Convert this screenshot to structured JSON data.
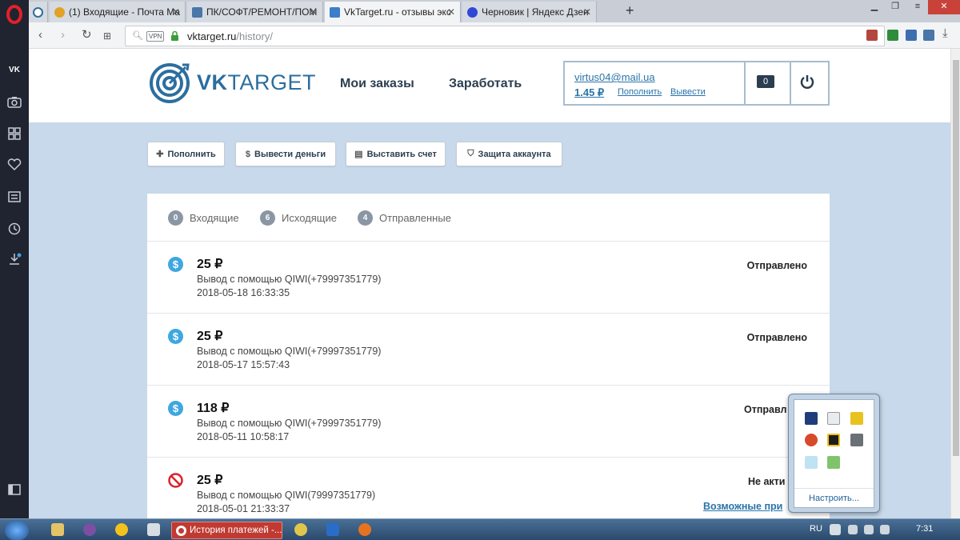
{
  "browser": {
    "tabs": [
      {
        "title": "(1) Входящие - Почта Ма",
        "favicon": "mail-icon",
        "color": "#e0a227"
      },
      {
        "title": "ПК/СОФТ/РЕМОНТ/ПОМ",
        "favicon": "vk-icon",
        "color": "#4a76a8"
      },
      {
        "title": "VkTarget.ru - отзывы экс",
        "favicon": "vk-like-icon",
        "color": "#3d7ec9"
      },
      {
        "title": "Черновик | Яндекс Дзен",
        "favicon": "zen-icon",
        "color": "#3147d6"
      }
    ],
    "address": {
      "vpn_label": "VPN",
      "host": "vktarget.ru",
      "path": "/history/"
    }
  },
  "site": {
    "brand_vk": "VK",
    "brand_target": "TARGET",
    "nav": {
      "orders": "Мои заказы",
      "earn": "Заработать"
    },
    "account": {
      "email": "virtus04@mail.ua",
      "balance": "1.45 ₽",
      "deposit_link": "Пополнить",
      "withdraw_link": "Вывести",
      "notifications": "0"
    }
  },
  "actions": {
    "deposit": "Пополнить",
    "withdraw": "Вывести деньги",
    "invoice": "Выставить счет",
    "security": "Защита аккаунта"
  },
  "filters": [
    {
      "count": "0",
      "label": "Входящие"
    },
    {
      "count": "6",
      "label": "Исходящие"
    },
    {
      "count": "4",
      "label": "Отправленные"
    }
  ],
  "transactions": [
    {
      "amount": "25 ₽",
      "description": "Вывод с помощью QIWI(+79997351779)",
      "date": "2018-05-18 16:33:35",
      "status": "Отправлено",
      "kind": "dollar-icon"
    },
    {
      "amount": "25 ₽",
      "description": "Вывод с помощью QIWI(+79997351779)",
      "date": "2018-05-17 15:57:43",
      "status": "Отправлено",
      "kind": "dollar-icon"
    },
    {
      "amount": "118 ₽",
      "description": "Вывод с помощью QIWI(+79997351779)",
      "date": "2018-05-11 10:58:17",
      "status": "Отправл",
      "kind": "dollar-icon"
    },
    {
      "amount": "25 ₽",
      "description": "Вывод с помощью QIWI(79997351779)",
      "date": "2018-05-01 21:33:37",
      "status": "Не акти",
      "kind": "cancelled-icon"
    }
  ],
  "possible_link": "Возможные при",
  "tray_popup": {
    "configure": "Настроить..."
  },
  "taskbar": {
    "active_task": "История платежей -...",
    "language": "RU",
    "time": "7:31"
  },
  "colors": {
    "brand": "#2c6e9e",
    "page_bg": "#c7d9ea",
    "dollar": "#3ea7e0",
    "cancel": "#d9232a"
  }
}
